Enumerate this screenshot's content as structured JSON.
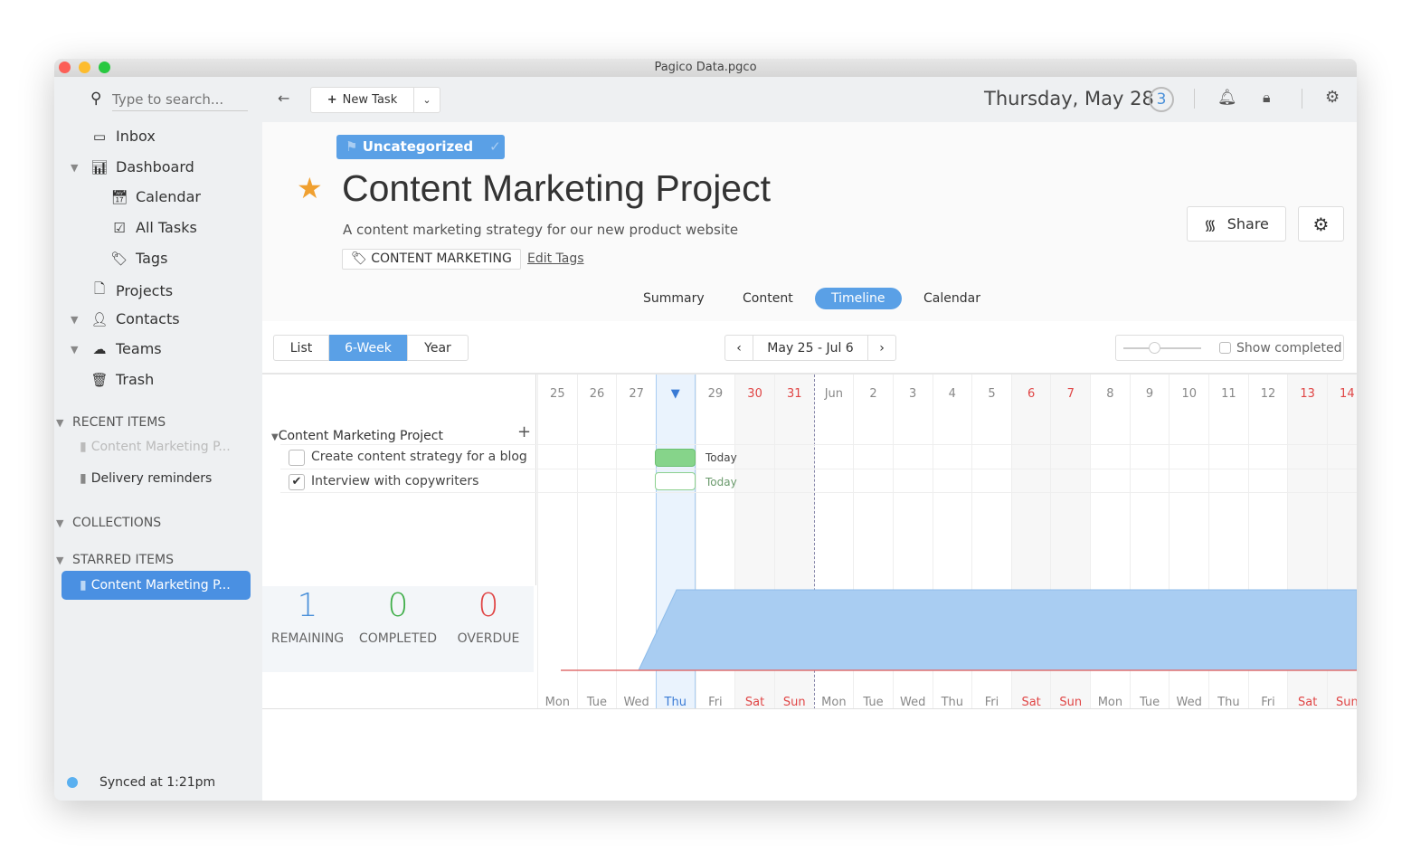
{
  "window": {
    "title": "Pagico Data.pgco"
  },
  "toolbar": {
    "search_placeholder": "Type to search...",
    "new_task": "New Task",
    "date": "Thursday, May 28",
    "badge": "3"
  },
  "sidebar": {
    "items": [
      {
        "label": "Inbox",
        "icon": "inbox-icon"
      },
      {
        "label": "Dashboard",
        "icon": "chart-icon"
      },
      {
        "label": "Calendar",
        "icon": "calendar-icon"
      },
      {
        "label": "All Tasks",
        "icon": "checkbox-icon"
      },
      {
        "label": "Tags",
        "icon": "tags-icon"
      },
      {
        "label": "Projects",
        "icon": "document-icon"
      },
      {
        "label": "Contacts",
        "icon": "person-icon"
      },
      {
        "label": "Teams",
        "icon": "cloud-icon"
      },
      {
        "label": "Trash",
        "icon": "trash-icon"
      }
    ],
    "recent_title": "RECENT ITEMS",
    "recent": [
      "Content Marketing P...",
      "Delivery reminders"
    ],
    "collections_title": "COLLECTIONS",
    "starred_title": "STARRED ITEMS",
    "starred": [
      "Content Marketing P..."
    ],
    "sync": "Synced at 1:21pm"
  },
  "project": {
    "category": "Uncategorized",
    "title": "Content Marketing Project",
    "description": "A content marketing strategy for our new product website",
    "tag": "CONTENT MARKETING",
    "edit_tags": "Edit Tags",
    "share": "Share",
    "starred": true
  },
  "tabs": [
    "Summary",
    "Content",
    "Timeline",
    "Calendar"
  ],
  "active_tab": "Timeline",
  "views": [
    "List",
    "6-Week",
    "Year"
  ],
  "active_view": "6-Week",
  "range": "May 25 - Jul 6",
  "show_completed": "Show completed",
  "show_completed_checked": false,
  "timeline": {
    "group": "Content Marketing Project",
    "tasks": [
      {
        "name": "Create content strategy for a blog",
        "done": false,
        "label": "Today"
      },
      {
        "name": "Interview with copywriters",
        "done": true,
        "label": "Today"
      }
    ],
    "days": [
      "25",
      "26",
      "27",
      "▼",
      "29",
      "30",
      "31",
      "Jun",
      "2",
      "3",
      "4",
      "5",
      "6",
      "7",
      "8",
      "9",
      "10",
      "11",
      "12",
      "13",
      "14"
    ],
    "weekdays": [
      "Mon",
      "Tue",
      "Wed",
      "Thu",
      "Fri",
      "Sat",
      "Sun",
      "Mon",
      "Tue",
      "Wed",
      "Thu",
      "Fri",
      "Sat",
      "Sun",
      "Mon",
      "Tue",
      "Wed",
      "Thu",
      "Fri",
      "Sat",
      "Sun"
    ]
  },
  "stats": [
    {
      "value": "1",
      "label": "REMAINING",
      "color": "#4a90d9"
    },
    {
      "value": "0",
      "label": "COMPLETED",
      "color": "#3fae49"
    },
    {
      "value": "0",
      "label": "OVERDUE",
      "color": "#e04545"
    }
  ],
  "colors": {
    "accent": "#5aa0e6",
    "weekend": "#e04545",
    "bar": "#86d48a"
  }
}
